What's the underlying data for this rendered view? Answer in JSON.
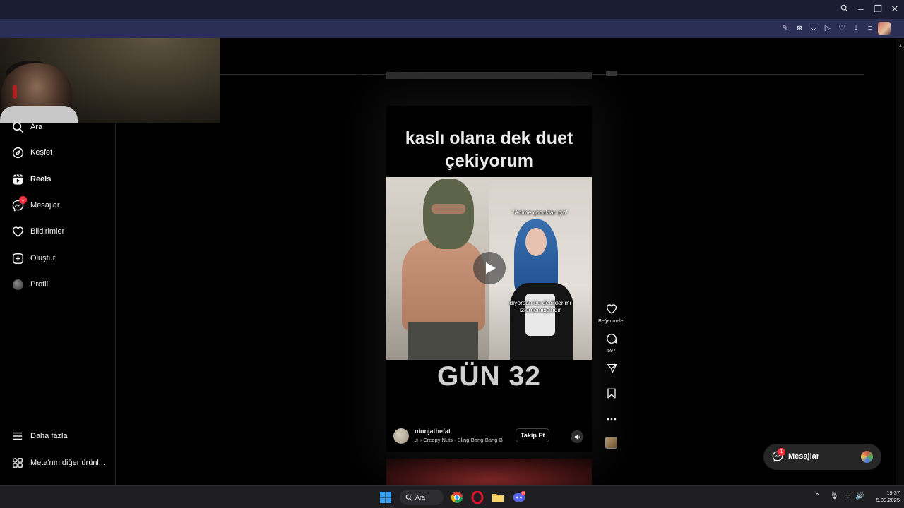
{
  "sidebar": {
    "items": [
      {
        "label": "Ara",
        "icon": "search-icon"
      },
      {
        "label": "Keşfet",
        "icon": "compass-icon"
      },
      {
        "label": "Reels",
        "icon": "reels-icon"
      },
      {
        "label": "Mesajlar",
        "icon": "messenger-icon",
        "badge": "1"
      },
      {
        "label": "Bildirimler",
        "icon": "heart-icon"
      },
      {
        "label": "Oluştur",
        "icon": "plus-square-icon"
      },
      {
        "label": "Profil",
        "icon": "avatar"
      },
      {
        "label": "Daha fazla",
        "icon": "menu-icon"
      },
      {
        "label": "Meta'nın diğer ürünl...",
        "icon": "grid-icon"
      }
    ]
  },
  "reel": {
    "caption_line1": "kaslı olana dek duet",
    "caption_line2": "çekiyorum",
    "video_text_top": "\"Anime çocuklar için\"",
    "video_text_bottom_1": "diyorsan bu dediklerimi",
    "video_text_bottom_2": "izlememişsindir",
    "day_label": "GÜN 32",
    "author": "ninnjathefat",
    "music": "♫ › Creepy Nuts · Bling-Bang-Bang-B",
    "follow_label": "Takip Et"
  },
  "actions": {
    "like_label": "Beğenmeler",
    "comments_count": "597"
  },
  "messages_pill": {
    "label": "Mesajlar",
    "badge": "1"
  },
  "taskbar": {
    "search_label": "Ara",
    "time": "19:37",
    "date": "5.09.2025",
    "discord_badge": "99"
  },
  "colors": {
    "accent_red": "#ff3040",
    "browser_titlebar": "#1b1d33",
    "browser_addrbar": "#2b2f55"
  }
}
